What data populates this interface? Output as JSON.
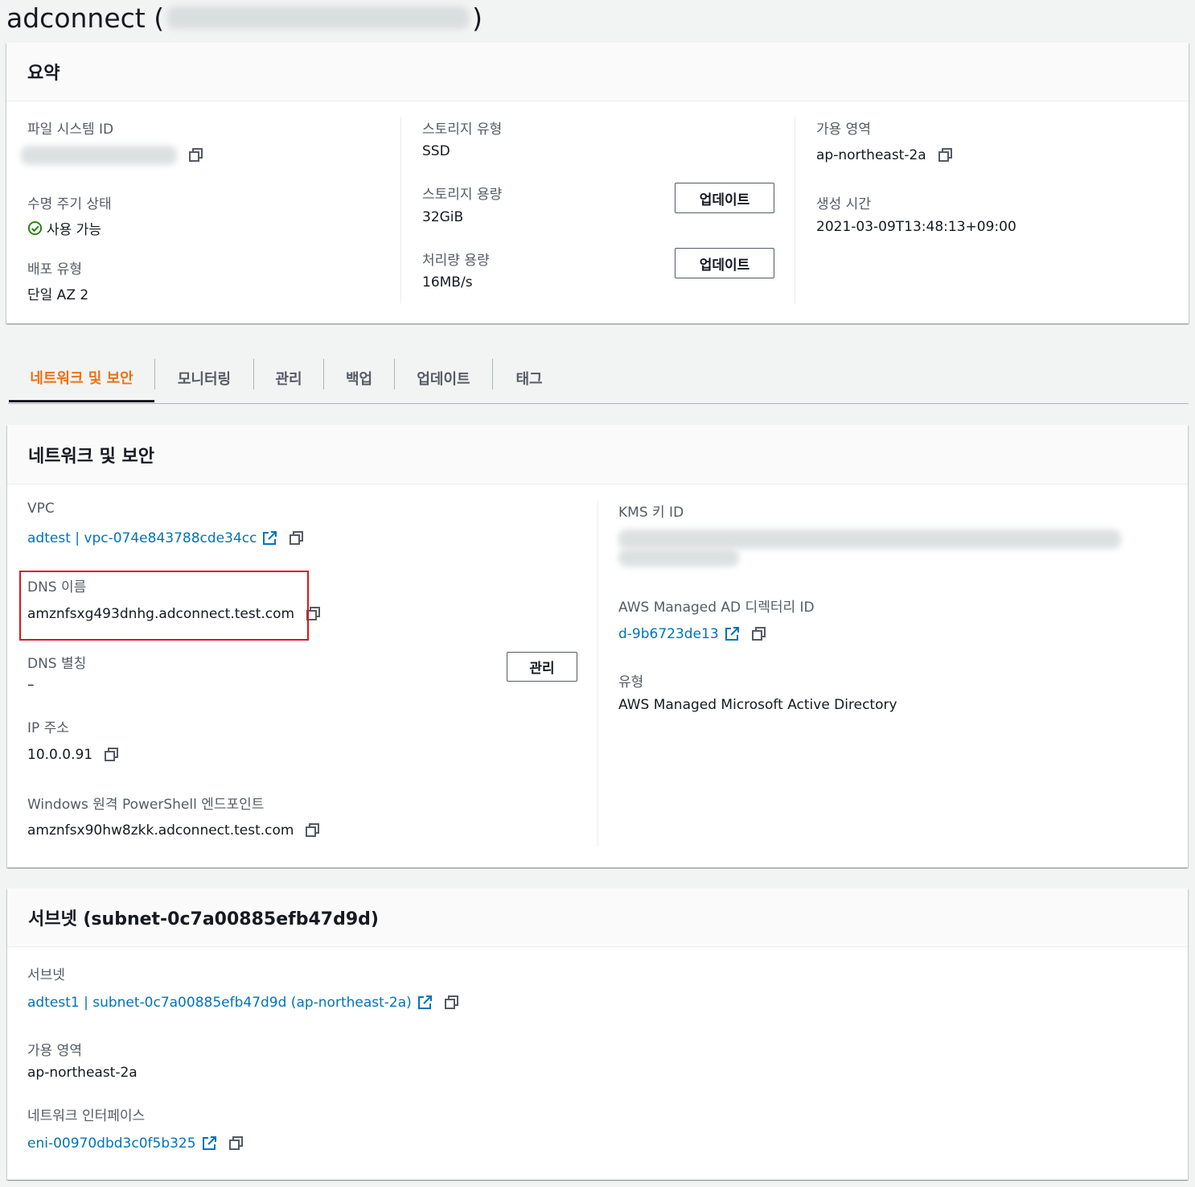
{
  "page": {
    "title_prefix": "adconnect (",
    "title_suffix": ")"
  },
  "summary": {
    "header": "요약",
    "file_system_id_label": "파일 시스템 ID",
    "lifecycle_label": "수명 주기 상태",
    "lifecycle_value": "사용 가능",
    "deployment_label": "배포 유형",
    "deployment_value": "단일 AZ 2",
    "storage_type_label": "스토리지 유형",
    "storage_type_value": "SSD",
    "storage_capacity_label": "스토리지 용량",
    "storage_capacity_value": "32GiB",
    "throughput_label": "처리량 용량",
    "throughput_value": "16MB/s",
    "update_button_1": "업데이트",
    "update_button_2": "업데이트",
    "az_label": "가용 영역",
    "az_value": "ap-northeast-2a",
    "created_label": "생성 시간",
    "created_value": "2021-03-09T13:48:13+09:00"
  },
  "tabs": [
    {
      "label": "네트워크 및 보안",
      "active": true
    },
    {
      "label": "모니터링",
      "active": false
    },
    {
      "label": "관리",
      "active": false
    },
    {
      "label": "백업",
      "active": false
    },
    {
      "label": "업데이트",
      "active": false
    },
    {
      "label": "태그",
      "active": false
    }
  ],
  "network": {
    "header": "네트워크 및 보안",
    "vpc_label": "VPC",
    "vpc_value": "adtest | vpc-074e843788cde34cc",
    "dns_name_label": "DNS 이름",
    "dns_name_value": "amznfsxg493dnhg.adconnect.test.com",
    "dns_alias_label": "DNS 별칭",
    "dns_alias_value": "–",
    "manage_button": "관리",
    "ip_label": "IP 주소",
    "ip_value": "10.0.0.91",
    "powershell_label": "Windows 원격 PowerShell 엔드포인트",
    "powershell_value": "amznfsx90hw8zkk.adconnect.test.com",
    "kms_label": "KMS 키 ID",
    "ad_label": "AWS Managed AD 디렉터리 ID",
    "ad_value": "d-9b6723de13",
    "type_label": "유형",
    "type_value": "AWS Managed Microsoft Active Directory"
  },
  "subnet": {
    "header": "서브넷 (subnet-0c7a00885efb47d9d)",
    "subnet_label": "서브넷",
    "subnet_value": "adtest1 | subnet-0c7a00885efb47d9d (ap-northeast-2a)",
    "az_label": "가용 영역",
    "az_value": "ap-northeast-2a",
    "eni_label": "네트워크 인터페이스",
    "eni_value": "eni-00970dbd3c0f5b325"
  },
  "colors": {
    "link": "#0073bb",
    "active_tab": "#ec7211",
    "success": "#1d8102",
    "highlight": "#e0131c"
  }
}
